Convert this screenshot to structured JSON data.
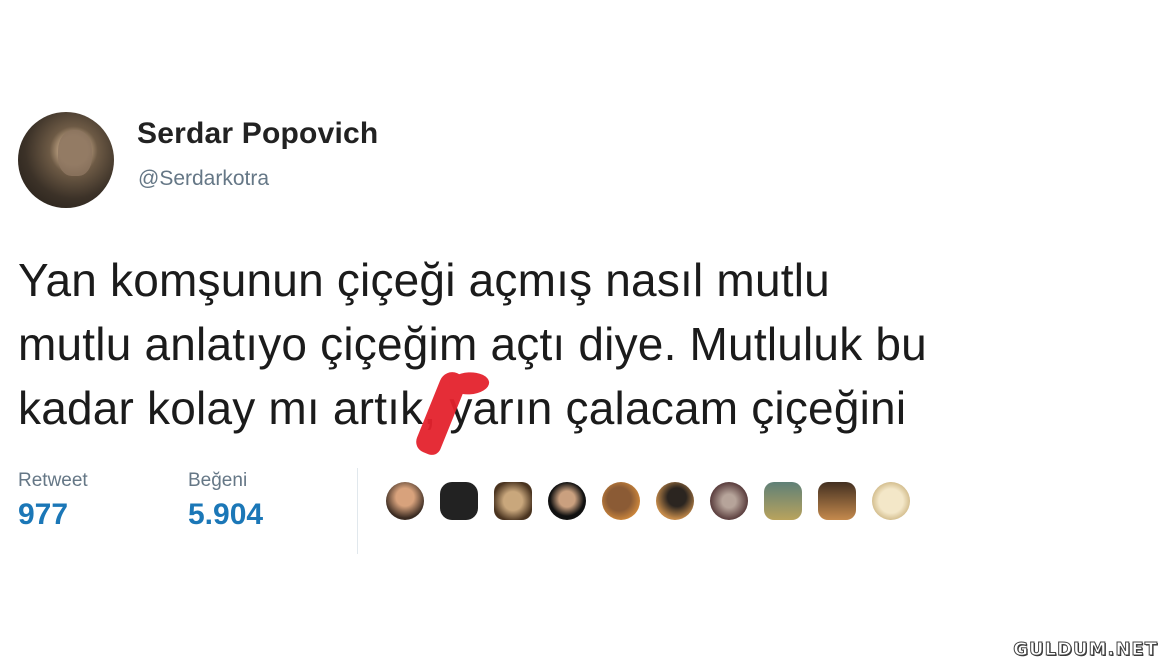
{
  "author": {
    "name": "Serdar Popovich",
    "handle": "@Serdarkotra"
  },
  "tweet": {
    "lines": [
      "Yan komşunun çiçeği açmış nasıl mutlu",
      "mutlu anlatıyo çiçeğim açtı diye. Mutluluk bu",
      "kadar kolay mı artık, yarın çalacam çiçeğini"
    ]
  },
  "stats": {
    "retweet_label": "Retweet",
    "retweet_count": "977",
    "like_label": "Beğeni",
    "like_count": "5.904",
    "value_color": "#1b77b7"
  },
  "likers_count_shown": 10,
  "watermark": "GULDUM.NET"
}
